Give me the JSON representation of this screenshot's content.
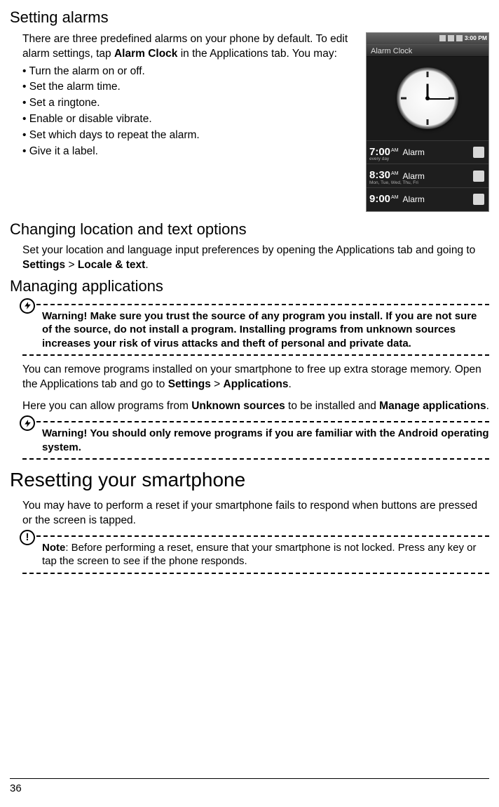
{
  "section1": {
    "title": "Setting alarms",
    "intro_a": "There are three predefined alarms on your phone by default. To edit alarm settings, tap ",
    "intro_b": "Alarm Clock",
    "intro_c": " in the Applications tab. You may:",
    "bullets": [
      "Turn the alarm on or off.",
      "Set the alarm time.",
      "Set a ringtone.",
      "Enable or disable vibrate.",
      "Set which days to repeat the alarm.",
      "Give it a label."
    ]
  },
  "phone": {
    "time": "3:00 PM",
    "title": "Alarm Clock",
    "rows": [
      {
        "time": "7:00",
        "ampm": "AM",
        "label": "Alarm",
        "days": "every day"
      },
      {
        "time": "8:30",
        "ampm": "AM",
        "label": "Alarm",
        "days": "Mon, Tue, Wed, Thu, Fri"
      },
      {
        "time": "9:00",
        "ampm": "AM",
        "label": "Alarm",
        "days": ""
      }
    ]
  },
  "section2": {
    "title": "Changing location and text options",
    "p_a": "Set your location and language input preferences by opening the Applications tab and going to ",
    "p_b": "Settings",
    "p_c": " > ",
    "p_d": "Locale & text",
    "p_e": "."
  },
  "section3": {
    "title": "Managing applications",
    "warn1": "Warning! Make sure you trust the source of any program you install. If you are not sure of the source, do not install a program. Installing programs from unknown sources increases your risk of virus attacks and theft of personal and private data.",
    "p1_a": "You can remove programs installed on your smartphone to free up extra storage memory. Open the Applications tab and go to ",
    "p1_b": "Settings",
    "p1_c": " > ",
    "p1_d": "Applications",
    "p1_e": ".",
    "p2_a": "Here you can allow programs from ",
    "p2_b": "Unknown sources",
    "p2_c": " to be installed and ",
    "p2_d": "Manage applications",
    "p2_e": ".",
    "warn2": "Warning! You should only remove programs if you are familiar with the Android operating system."
  },
  "section4": {
    "title": "Resetting your smartphone",
    "p1": "You may have to perform a reset if your smartphone fails to respond when buttons are pressed or the screen is tapped.",
    "note_label": "Note",
    "note_body": ": Before performing a reset, ensure that your smartphone is not locked. Press any key or tap the screen to see if the phone responds."
  },
  "page_number": "36"
}
